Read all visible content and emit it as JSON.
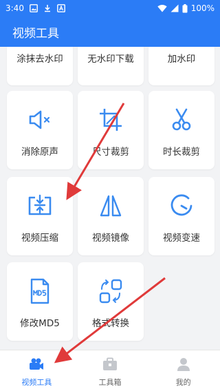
{
  "status_bar": {
    "time": "3:40",
    "battery": "100%"
  },
  "app_bar": {
    "title": "视频工具"
  },
  "tools": [
    {
      "label": "涂抹去水印",
      "icon": ""
    },
    {
      "label": "无水印下载",
      "icon": ""
    },
    {
      "label": "加水印",
      "icon": ""
    },
    {
      "label": "消除原声",
      "icon": "mute-speaker-icon"
    },
    {
      "label": "尺寸裁剪",
      "icon": "crop-icon"
    },
    {
      "label": "时长裁剪",
      "icon": "scissors-icon"
    },
    {
      "label": "视频压缩",
      "icon": "compress-icon"
    },
    {
      "label": "视频镜像",
      "icon": "mirror-icon"
    },
    {
      "label": "视频变速",
      "icon": "speedometer-icon"
    },
    {
      "label": "修改MD5",
      "icon": "md5-file-icon"
    },
    {
      "label": "格式转换",
      "icon": "format-convert-icon"
    }
  ],
  "bottom_nav": [
    {
      "label": "视频工具",
      "active": true
    },
    {
      "label": "工具箱",
      "active": false
    },
    {
      "label": "我的",
      "active": false
    }
  ],
  "colors": {
    "accent": "#2b7cf6",
    "icon_blue": "#3a8bf0",
    "annotation_red": "#e03a3a",
    "nav_gray": "#c4c7cc"
  }
}
